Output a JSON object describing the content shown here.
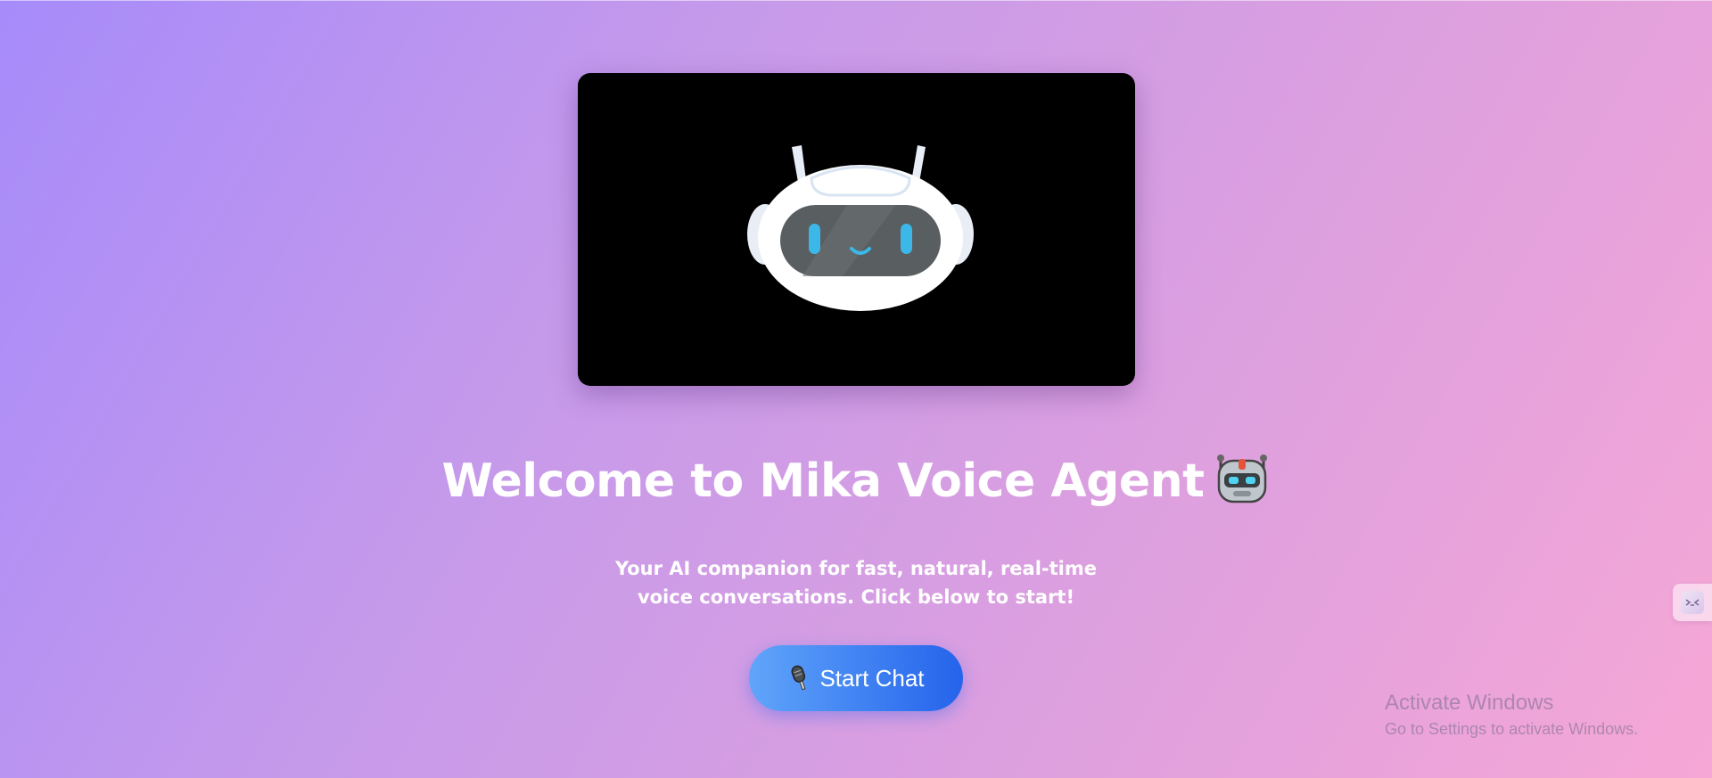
{
  "hero": {
    "image_icon": "robot-face-icon"
  },
  "welcome": {
    "title": "Welcome to Mika Voice Agent",
    "title_icon": "robot-emoji-icon",
    "subtitle": "Your AI companion for fast, natural, real-time voice conversations. Click below to start!"
  },
  "actions": {
    "start_chat_label": "Start Chat",
    "start_chat_icon": "microphone-icon"
  },
  "side_widget": {
    "icon": "chat-face-icon"
  },
  "windows_watermark": {
    "title": "Activate Windows",
    "subtitle": "Go to Settings to activate Windows."
  },
  "colors": {
    "background_start": "#a78bfa",
    "background_end": "#f6a7d6",
    "button_start": "#60a5fa",
    "button_end": "#2563eb",
    "text": "#ffffff"
  }
}
